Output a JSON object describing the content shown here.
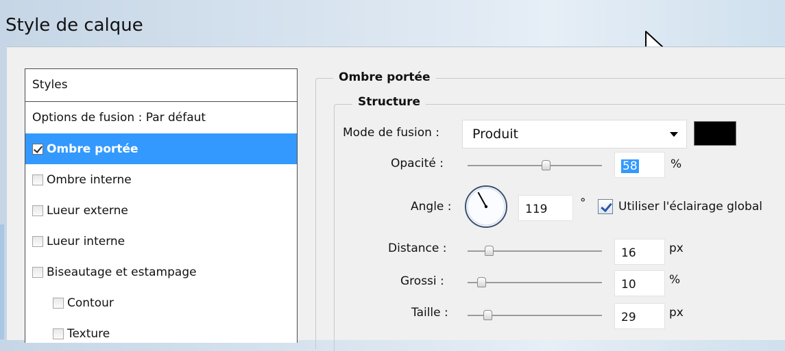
{
  "window": {
    "title": "Style de calque"
  },
  "styles_list": {
    "header": "Styles",
    "items": [
      {
        "label": "Options de fusion : Par défaut",
        "checkbox": false,
        "checked": false,
        "selected": false,
        "indent": false
      },
      {
        "label": "Ombre portée",
        "checkbox": true,
        "checked": true,
        "selected": true,
        "indent": false
      },
      {
        "label": "Ombre interne",
        "checkbox": true,
        "checked": false,
        "selected": false,
        "indent": false
      },
      {
        "label": "Lueur externe",
        "checkbox": true,
        "checked": false,
        "selected": false,
        "indent": false
      },
      {
        "label": "Lueur interne",
        "checkbox": true,
        "checked": false,
        "selected": false,
        "indent": false
      },
      {
        "label": "Biseautage et estampage",
        "checkbox": true,
        "checked": false,
        "selected": false,
        "indent": false
      },
      {
        "label": "Contour",
        "checkbox": true,
        "checked": false,
        "selected": false,
        "indent": true
      },
      {
        "label": "Texture",
        "checkbox": true,
        "checked": false,
        "selected": false,
        "indent": true
      }
    ]
  },
  "drop_shadow": {
    "section_title": "Ombre portée",
    "structure_title": "Structure",
    "blend_mode": {
      "label": "Mode de fusion :",
      "value": "Produit",
      "color": "#000000"
    },
    "opacity": {
      "label": "Opacité :",
      "value": "58",
      "unit": "%",
      "slider_fraction": 0.58
    },
    "angle": {
      "label": "Angle :",
      "value": "119",
      "unit": "°",
      "degrees": 119,
      "use_global_label": "Utiliser l'éclairage global",
      "use_global_checked": true
    },
    "distance": {
      "label": "Distance :",
      "value": "16",
      "unit": "px",
      "slider_fraction": 0.16
    },
    "spread": {
      "label": "Grossi :",
      "value": "10",
      "unit": "%",
      "slider_fraction": 0.1
    },
    "size": {
      "label": "Taille :",
      "value": "29",
      "unit": "px",
      "slider_fraction": 0.15
    }
  },
  "colors": {
    "selection": "#3399ff",
    "dialog_bg": "#f0f0f0"
  }
}
